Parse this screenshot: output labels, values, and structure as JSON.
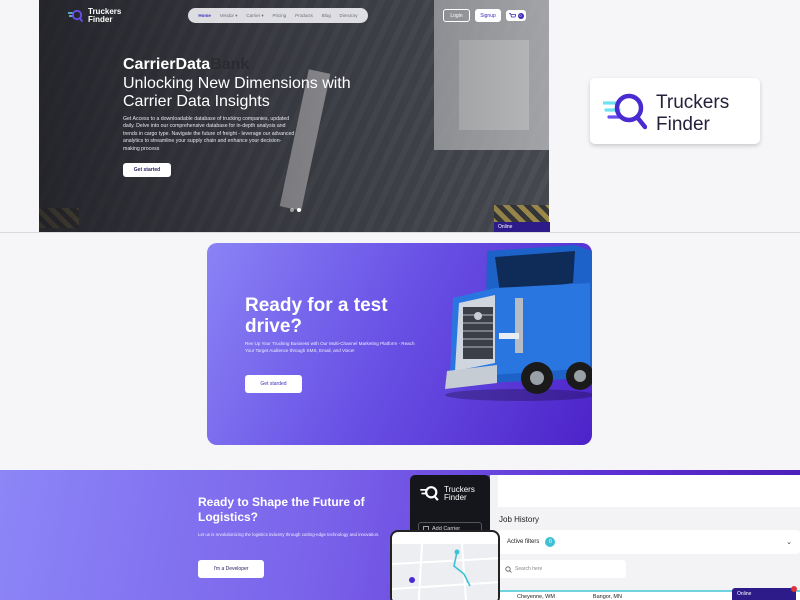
{
  "hero": {
    "logo": {
      "line1": "Truckers",
      "line2": "Finder"
    },
    "nav": [
      "Home",
      "Vendor",
      "Carrier",
      "Pricing",
      "Products",
      "Blog",
      "Directory"
    ],
    "login": "Login",
    "signup": "Signup",
    "cart_count": "0",
    "title_part1": "CarrierData",
    "title_part2": "Bank",
    "subtitle": "Unlocking New Dimensions with Carrier Data Insights",
    "description": "Get Access to a downloadable database of trucking companies, updated daily. Delve into our comprehensive database for in-depth analysis and trends in cargo type. Navigate the future of freight - leverage our advanced analytics to streamline your supply chain and enhance your decision-making process",
    "cta": "Get started",
    "status": "Online"
  },
  "brand": {
    "line1": "Truckers",
    "line2": "Finder",
    "color": "#4a2bd1"
  },
  "test_drive": {
    "title": "Ready for  a test drive?",
    "description": "Rev Up Your Trucking Business with Our Multi-Channel Marketing Platform - Reach Your Target Audience through SMS, Email, and Voice!",
    "cta": "Get starded"
  },
  "future": {
    "title": "Ready to Shape the Future of Logistics?",
    "description": "Let us is revolutionizing the logistics industry through cutting-edge technology and innovation.",
    "cta": "I'm a Developer"
  },
  "dashboard": {
    "logo": {
      "line1": "Truckers",
      "line2": "Finder"
    },
    "add_carrier": "Add Carrier",
    "job_history": "Job History",
    "active_filters": "Active filters",
    "filter_count": "0",
    "search_placeholder": "Search here",
    "row": [
      "Cheyenne, WM",
      "Bangor, MN"
    ]
  },
  "status_bottom": "Online"
}
